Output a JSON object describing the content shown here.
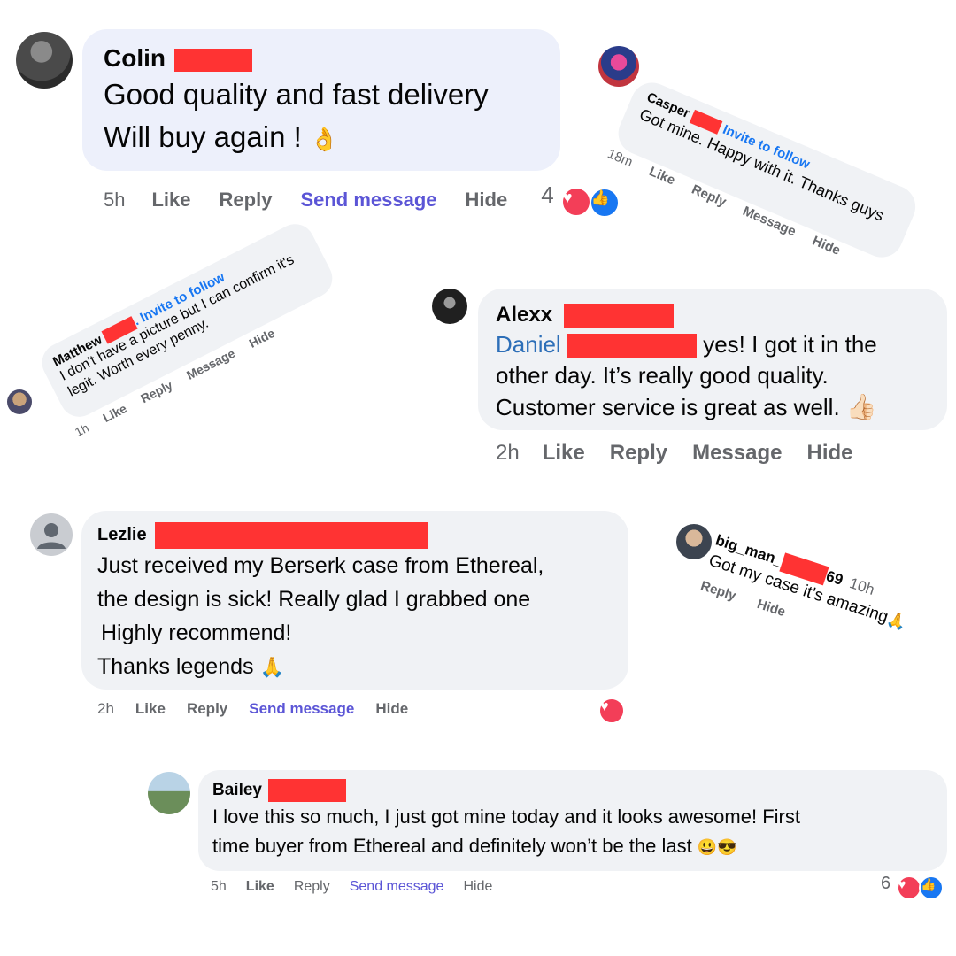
{
  "colin": {
    "name": "Colin",
    "line1": "Good quality and fast delivery",
    "line2": "Will buy again !",
    "emoji": "👌",
    "time": "5h",
    "like": "Like",
    "reply": "Reply",
    "send": "Send message",
    "hide": "Hide",
    "react_count": "4"
  },
  "casper": {
    "name": "Casper",
    "follow": "Invite to follow",
    "text": "Got mine. Happy with it. Thanks guys",
    "time": "18m",
    "like": "Like",
    "reply": "Reply",
    "message": "Message",
    "hide": "Hide"
  },
  "matthew": {
    "name": "Matthew",
    "follow": ". Invite to follow",
    "text": "I don't have a picture but I can confirm it's legit. Worth every penny.",
    "time": "1h",
    "like": "Like",
    "reply": "Reply",
    "message": "Message",
    "hide": "Hide"
  },
  "alexx": {
    "name": "Alexx",
    "mention": "Daniel",
    "line1": "yes! I got it in the",
    "line2": "other day. It’s really good quality.",
    "line3": "Customer service is great as well.",
    "emoji": "👍🏻",
    "time": "2h",
    "like": "Like",
    "reply": "Reply",
    "message": "Message",
    "hide": "Hide"
  },
  "lezlie": {
    "name": "Lezlie",
    "line1": "Just received my Berserk case from Ethereal,",
    "line2": "the design is sick! Really glad I grabbed one",
    "line3": "Highly recommend!",
    "line4": "Thanks legends",
    "emoji": "🙏",
    "time": "2h",
    "like": "Like",
    "reply": "Reply",
    "send": "Send message",
    "hide": "Hide"
  },
  "bigman": {
    "name_prefix": "big_man_",
    "name_suffix": "69",
    "time": "10h",
    "text": "Got my case it's amazing",
    "emoji": "🙏",
    "reply": "Reply",
    "hide": "Hide"
  },
  "bailey": {
    "name": "Bailey",
    "line1": "I love this so much, I just got mine today and it looks awesome! First",
    "line2": "time buyer from Ethereal and definitely won’t be the last",
    "emoji": "😃😎",
    "time": "5h",
    "like": "Like",
    "reply": "Reply",
    "send": "Send message",
    "hide": "Hide",
    "react_count": "6"
  },
  "colors": {
    "redaction": "#ff3333",
    "send_message": "#5b55d6",
    "link_blue": "#1877f2",
    "heart": "#f33e58"
  }
}
